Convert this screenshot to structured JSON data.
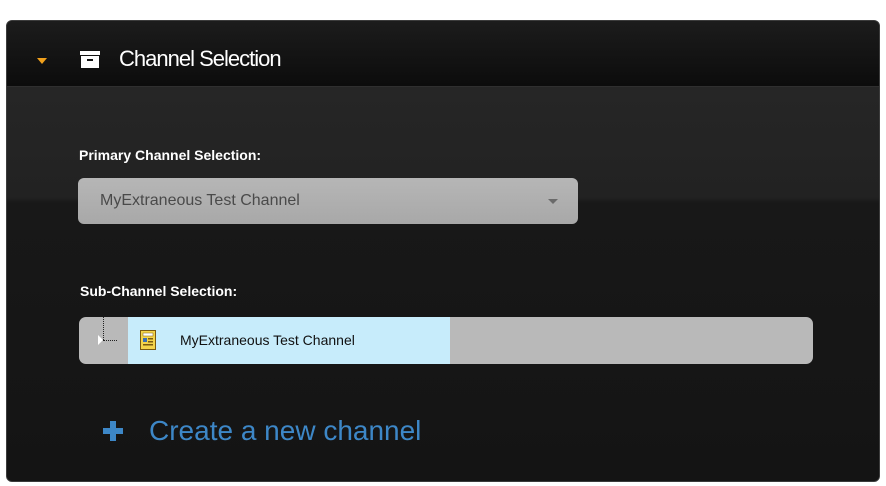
{
  "panel": {
    "title": "Channel Selection",
    "collapse_icon": "caret-down-icon",
    "title_icon": "archive-box-icon",
    "accent_color": "#f0a01c"
  },
  "primary": {
    "label": "Primary Channel Selection:",
    "selected_value": "MyExtraneous Test Channel"
  },
  "sub": {
    "label": "Sub-Channel Selection:",
    "tree_items": [
      {
        "label": "MyExtraneous Test Channel",
        "icon": "channel-document-icon",
        "selected": true
      }
    ]
  },
  "create": {
    "label": "Create a new channel",
    "icon": "plus-icon",
    "color": "#3d87c7"
  }
}
